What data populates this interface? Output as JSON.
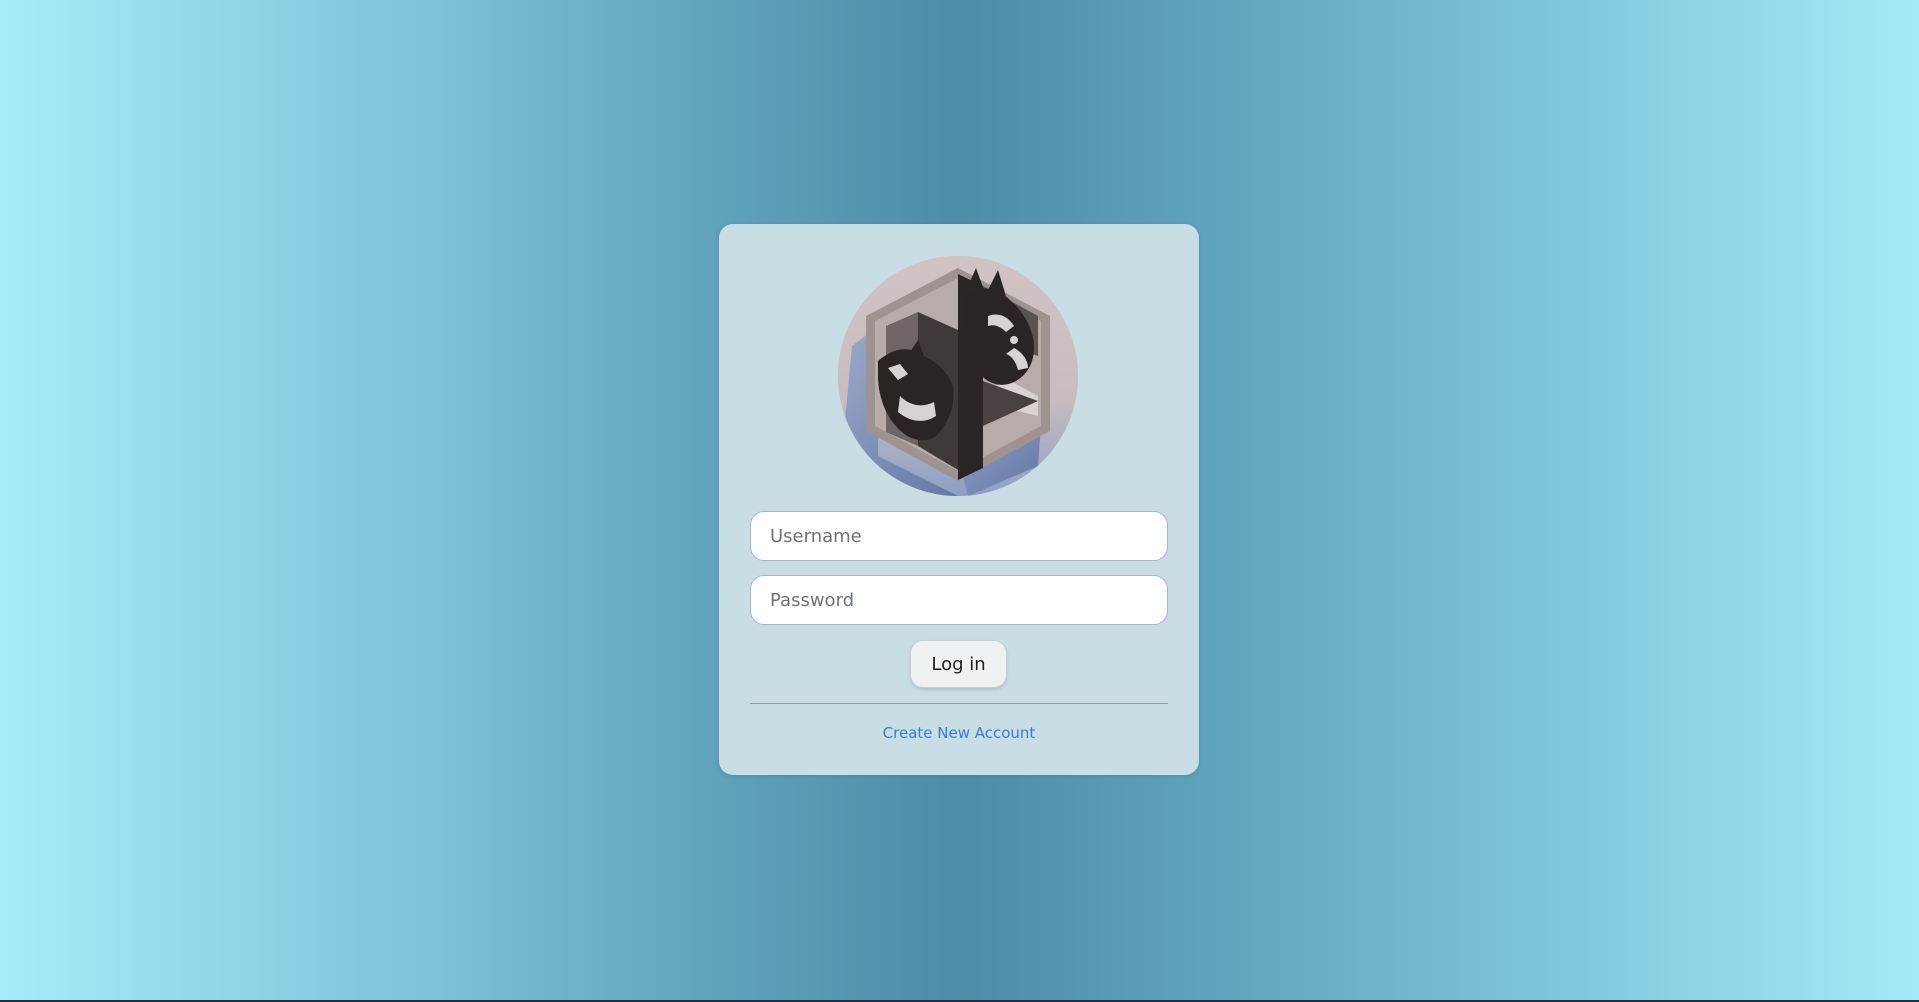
{
  "login": {
    "username_placeholder": "Username",
    "password_placeholder": "Password",
    "login_label": "Log in",
    "create_account_label": "Create New Account"
  },
  "logo": {
    "icon": "dog-emblem-logo"
  },
  "colors": {
    "background_center": "#4e8ca8",
    "background_edge": "#a6ecfa",
    "card": "#c8dde4",
    "link": "#3a7bd5"
  }
}
